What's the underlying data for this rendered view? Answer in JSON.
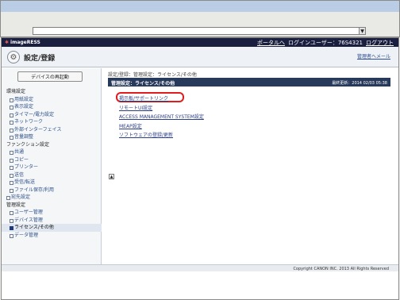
{
  "browser": {
    "address_value": "",
    "dropdown_glyph": "▼"
  },
  "header": {
    "brand": "imageRESS",
    "portal_link": "ポータルへ",
    "login_user": "ログインユーザー：76S4321",
    "logout_link": "ログアウト"
  },
  "page": {
    "title": "設定/登録",
    "manager_link": "管理者へメール"
  },
  "sidebar": {
    "restart_button": "デバイスの再起動",
    "sections": [
      {
        "label": "環境設定",
        "items": [
          "用紙設定",
          "表示設定",
          "タイマー/電力設定",
          "ネットワーク",
          "外部インターフェイス",
          "音量調整"
        ]
      },
      {
        "label": "ファンクション設定",
        "items": [
          "共通",
          "コピー",
          "プリンター",
          "送信",
          "受信/転送",
          "ファイル保存/利用"
        ]
      },
      {
        "label": "",
        "items": [
          "宛先設定"
        ],
        "top_level": true
      },
      {
        "label": "管理設定",
        "items": [
          "ユーザー管理",
          "デバイス管理",
          "ライセンス/その他",
          "データ管理"
        ],
        "active": "ライセンス/その他"
      }
    ]
  },
  "main": {
    "breadcrumb": "設定/登録：管理設定：ライセンス/その他",
    "section_title": "管理設定：ライセンス/その他",
    "last_updated": "最終更新：2014 02/03 05:38",
    "links": [
      "掲示板/サポートリンク",
      "リモートUI設定",
      "ACCESS MANAGEMENT SYSTEM設定",
      "MEAP設定",
      "ソフトウェアの登録/更新"
    ],
    "page_top_glyph": "▲"
  },
  "footer": {
    "copyright": "Copyright CANON INC. 2013 All Rights Reserved"
  },
  "colors": {
    "brand_bar": "#1b1f3f",
    "section_bar": "#283a5c",
    "link": "#2c3f86",
    "highlight": "#e01c1c"
  }
}
